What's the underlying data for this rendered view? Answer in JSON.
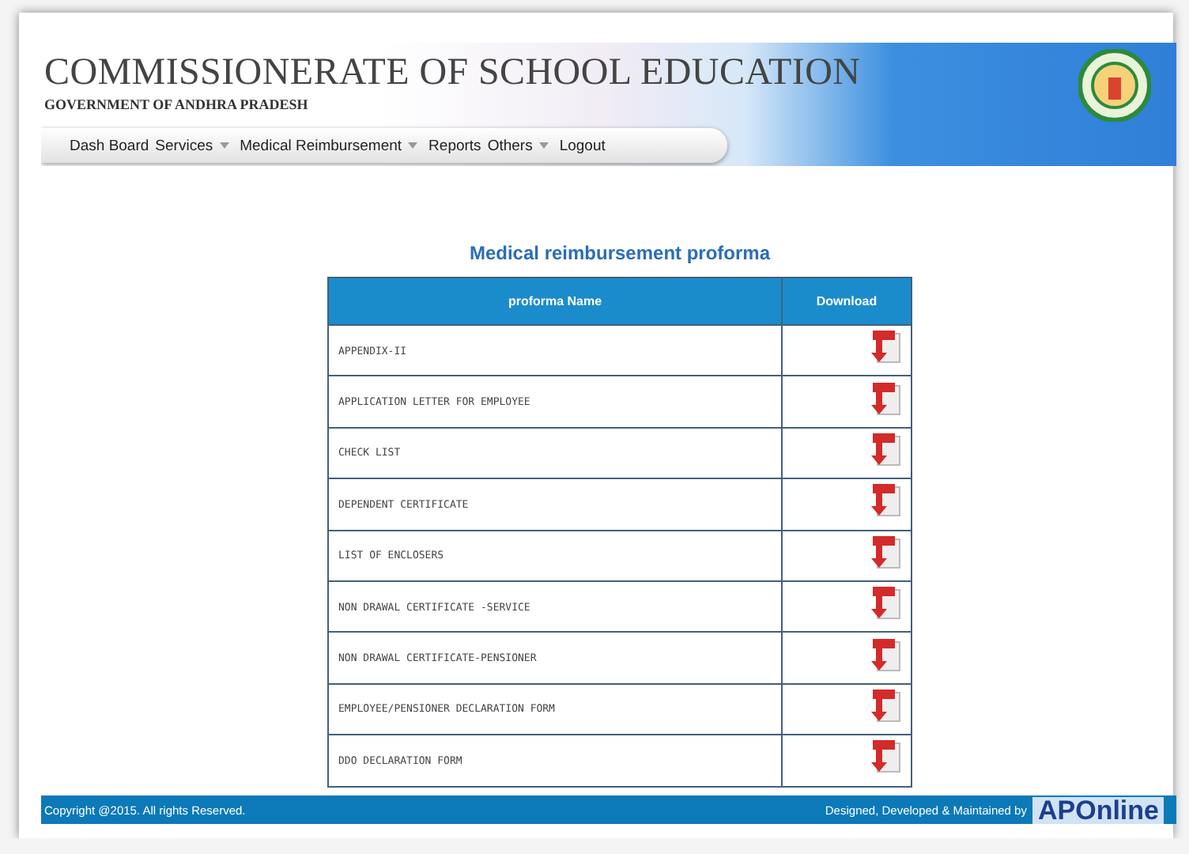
{
  "header": {
    "title": "COMMISSIONERATE OF SCHOOL EDUCATION",
    "subtitle": "GOVERNMENT OF ANDHRA PRADESH"
  },
  "nav": [
    {
      "label": "Dash Board",
      "dropdown": false
    },
    {
      "label": "Services",
      "dropdown": true
    },
    {
      "label": "Medical Reimbursement",
      "dropdown": true
    },
    {
      "label": "Reports",
      "dropdown": false
    },
    {
      "label": "Others",
      "dropdown": true
    },
    {
      "label": "Logout",
      "dropdown": false
    }
  ],
  "page_title": "Medical reimbursement proforma",
  "table": {
    "columns": [
      "proforma Name",
      "Download"
    ],
    "rows": [
      {
        "name": "APPENDIX-II"
      },
      {
        "name": "APPLICATION LETTER FOR EMPLOYEE"
      },
      {
        "name": "CHECK LIST"
      },
      {
        "name": "DEPENDENT CERTIFICATE"
      },
      {
        "name": "LIST OF ENCLOSERS"
      },
      {
        "name": "NON DRAWAL CERTIFICATE -SERVICE"
      },
      {
        "name": "NON DRAWAL CERTIFICATE-PENSIONER"
      },
      {
        "name": "EMPLOYEE/PENSIONER DECLARATION FORM"
      },
      {
        "name": "DDO DECLARATION FORM"
      }
    ]
  },
  "footer": {
    "copyright": "Copyright @2015. All rights Reserved.",
    "credit": "Designed, Developed & Maintained by",
    "logo": "APOnline"
  }
}
